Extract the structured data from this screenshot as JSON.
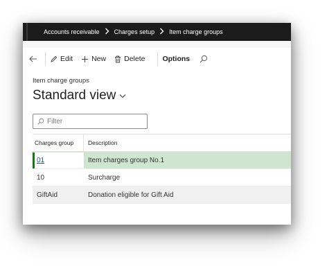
{
  "breadcrumb": {
    "items": [
      "Accounts receivable",
      "Charges setup",
      "Item charge groups"
    ]
  },
  "actions": {
    "edit": "Edit",
    "new": "New",
    "delete": "Delete",
    "options": "Options"
  },
  "page": {
    "caption": "Item charge groups",
    "view_name": "Standard view"
  },
  "filter": {
    "placeholder": "Filter"
  },
  "grid": {
    "columns": [
      "Charges group",
      "Description"
    ],
    "rows": [
      {
        "group": "01",
        "description": "Item charges group No.1"
      },
      {
        "group": "10",
        "description": "Surcharge"
      },
      {
        "group": "GiftAid",
        "description": "Donation eligible for Gift Aid"
      }
    ]
  },
  "colors": {
    "navbar": "#1b1b1b",
    "selected_row": "#cfe5cf",
    "selected_marker": "#107c10",
    "link": "#1c5a9e"
  }
}
